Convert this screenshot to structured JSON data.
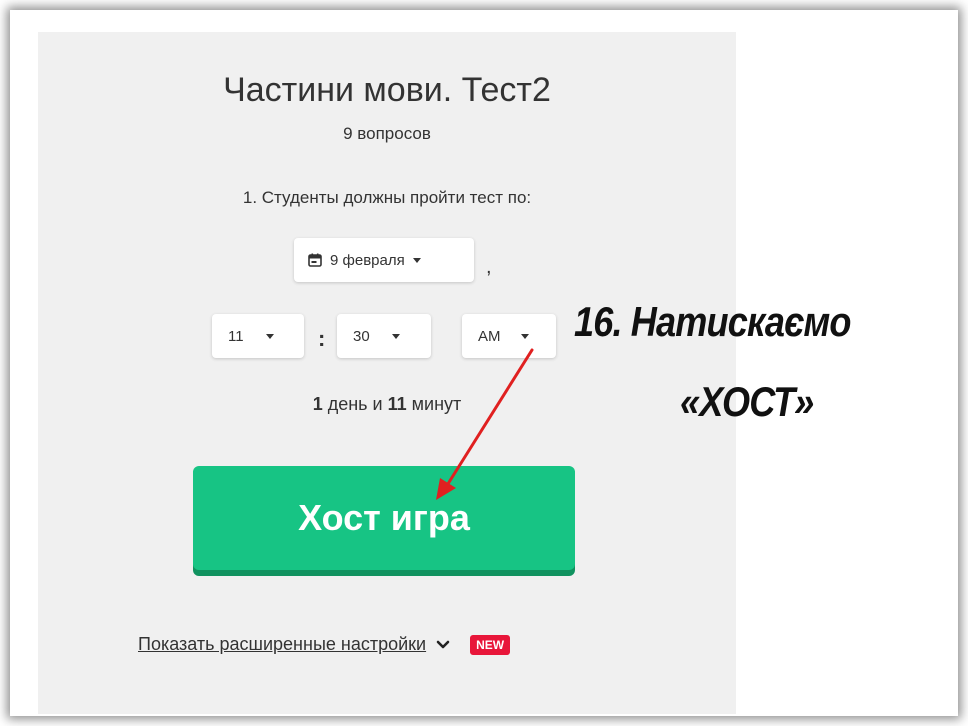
{
  "quiz": {
    "title": "Частини мови. Тест2",
    "question_count": "9 вопросов",
    "instruction": "1. Студенты должны пройти тест по:"
  },
  "deadline": {
    "date": "9 февраля",
    "separator": ",",
    "hour": "11",
    "time_separator": ":",
    "minute": "30",
    "ampm": "AM",
    "duration_days": "1",
    "duration_days_unit": "день и",
    "duration_minutes": "11",
    "duration_minutes_unit": "минут"
  },
  "host_button": {
    "label": "Хост игра",
    "color": "#17c484"
  },
  "advanced": {
    "link_label": "Показать расширенные настройки",
    "badge": "NEW",
    "badge_color": "#e8163a"
  },
  "annotation": {
    "line1": "16. Натискаємо",
    "line2": "«ХОСТ»",
    "arrow_color": "#e02020"
  },
  "icons": [
    "calendar-icon",
    "caret-down-icon",
    "chevron-down-icon"
  ]
}
